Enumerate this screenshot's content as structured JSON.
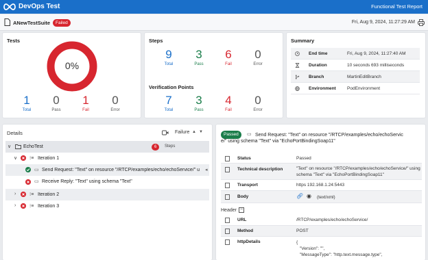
{
  "header": {
    "app_title": "DevOps Test",
    "report_type": "Functional Test Report"
  },
  "suite": {
    "name": "ANewTestSuite",
    "status": "Failed",
    "date": "Fri, Aug 9, 2024, 11:27:29 AM"
  },
  "tests": {
    "title": "Tests",
    "percent": "0%",
    "total": "1",
    "total_label": "Total",
    "pass": "0",
    "pass_label": "Pass",
    "fail": "1",
    "fail_label": "Fail",
    "error": "0",
    "error_label": "Error"
  },
  "steps": {
    "title": "Steps",
    "total": "9",
    "pass": "3",
    "fail": "6",
    "error": "0",
    "total_label": "Total",
    "pass_label": "Pass",
    "fail_label": "Fail",
    "error_label": "Error"
  },
  "verification": {
    "title": "Verification Points",
    "total": "7",
    "pass": "3",
    "fail": "4",
    "error": "0",
    "total_label": "Total",
    "pass_label": "Pass",
    "fail_label": "Fail",
    "error_label": "Error"
  },
  "summary": {
    "title": "Summary",
    "rows": [
      {
        "key": "End time",
        "value": "Fri, Aug 9, 2024, 11:27:40 AM",
        "icon": "clock-icon"
      },
      {
        "key": "Duration",
        "value": "10 seconds 693 milliseconds",
        "icon": "hourglass-icon"
      },
      {
        "key": "Branch",
        "value": "MartinEditBranch",
        "icon": "branch-icon"
      },
      {
        "key": "Environment",
        "value": "PodEnvironment",
        "icon": "globe-icon"
      }
    ]
  },
  "details": {
    "title": "Details",
    "filter": "Failure",
    "tree": {
      "root": "EchoTest",
      "root_count": "6",
      "root_count_label": "Steps",
      "iter1": "Iteration 1",
      "step1": "Send Request: \"Text\" on resource \"/RTCP/examples/echo/echoService/\" u",
      "step2": "Receive Reply: \"Text\" using schema \"Text\"",
      "iter2": "Iteration 2",
      "iter3": "Iteration 3"
    }
  },
  "detail": {
    "status_pill": "Passed",
    "title_line1": "Send Request: \"Text\" on resource \"/RTCP/examples/echo/echoServic",
    "title_line2": "e/\" using schema \"Text\" via \"EchoPortBindingSoap11\"",
    "rows": [
      {
        "key": "Status",
        "value": "Passed"
      },
      {
        "key": "Technical description",
        "value1": "\"Text\" on resource \"/RTCP/examples/echo/echoService/\" using",
        "value2": "schema \"Text\" via \"EchoPortBindingSoap11\""
      },
      {
        "key": "Transport",
        "value": "https 192.168.1.24:5443"
      },
      {
        "key": "Body",
        "value": "(text/xml)"
      }
    ],
    "header_label": "Header",
    "header_rows": [
      {
        "key": "URL",
        "value": "/RTCP/examples/echo/echoService/"
      },
      {
        "key": "Method",
        "value": "POST"
      },
      {
        "key": "httpDetails",
        "value1": "{",
        "value2": "\"Version\": \"\",",
        "value3": "\"MessageType\": \"http.text.message.type\","
      }
    ]
  },
  "colors": {
    "brand": "#1a6fc9",
    "fail": "#d7262f",
    "pass": "#1a7d4a"
  }
}
